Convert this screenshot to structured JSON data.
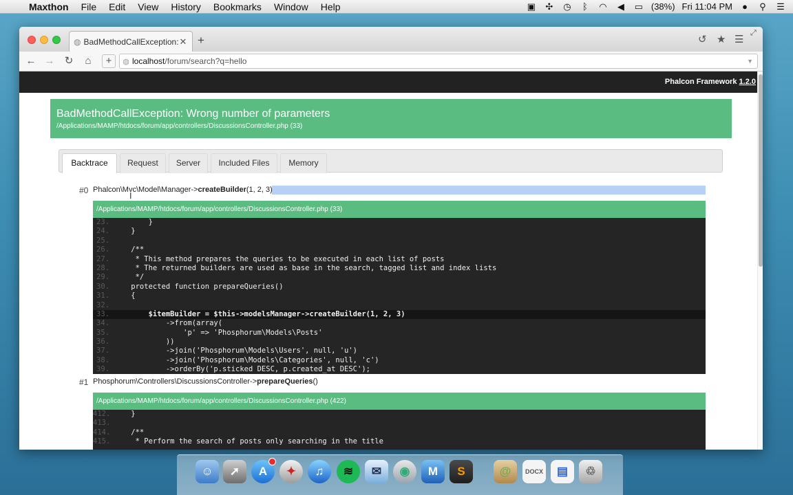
{
  "menubar": {
    "app_name": "Maxthon",
    "items": [
      "File",
      "Edit",
      "View",
      "History",
      "Bookmarks",
      "Window",
      "Help"
    ],
    "battery": "(38%)",
    "clock": "Fri 11:04 PM"
  },
  "browser": {
    "tab_title": "BadMethodCallException: W",
    "url_host": "localhost",
    "url_path": "/forum/search?q=hello"
  },
  "page": {
    "framework_label": "Phalcon Framework",
    "framework_version": "1.2.0",
    "error_title": "BadMethodCallException: Wrong number of parameters",
    "error_path": "/Applications/MAMP/htdocs/forum/app/controllers/DiscussionsController.php (33)",
    "tabs": [
      "Backtrace",
      "Request",
      "Server",
      "Included Files",
      "Memory"
    ],
    "trace0": {
      "num": "#0",
      "prefix": "Phalcon\\Mvc\\Model\\Manager->",
      "method": "createBuilder",
      "args": "(1, 2, 3)",
      "file": "/Applications/MAMP/htdocs/forum/app/controllers/DiscussionsController.php (33)"
    },
    "trace1": {
      "num": "#1",
      "prefix": "Phosphorum\\Controllers\\DiscussionsController->",
      "method": "prepareQueries",
      "args": "()",
      "file": "/Applications/MAMP/htdocs/forum/app/controllers/DiscussionsController.php (422)"
    },
    "code0": [
      {
        "num": "23.",
        "text": "        }"
      },
      {
        "num": "24.",
        "text": "    }"
      },
      {
        "num": "25.",
        "text": ""
      },
      {
        "num": "26.",
        "text": "    /**"
      },
      {
        "num": "27.",
        "text": "     * This method prepares the queries to be executed in each list of posts"
      },
      {
        "num": "28.",
        "text": "     * The returned builders are used as base in the search, tagged list and index lists"
      },
      {
        "num": "29.",
        "text": "     */"
      },
      {
        "num": "30.",
        "text": "    protected function prepareQueries()"
      },
      {
        "num": "31.",
        "text": "    {"
      },
      {
        "num": "32.",
        "text": ""
      },
      {
        "num": "33.",
        "text": "        $itemBuilder = $this->modelsManager->createBuilder(1, 2, 3)"
      },
      {
        "num": "34.",
        "text": "            ->from(array("
      },
      {
        "num": "35.",
        "text": "                'p' => 'Phosphorum\\Models\\Posts'"
      },
      {
        "num": "36.",
        "text": "            ))"
      },
      {
        "num": "37.",
        "text": "            ->join('Phosphorum\\Models\\Users', null, 'u')"
      },
      {
        "num": "38.",
        "text": "            ->join('Phosphorum\\Models\\Categories', null, 'c')"
      },
      {
        "num": "39.",
        "text": "            ->orderBy('p.sticked DESC, p.created_at DESC');"
      }
    ],
    "code1": [
      {
        "num": "412.",
        "text": "    }"
      },
      {
        "num": "413.",
        "text": ""
      },
      {
        "num": "414.",
        "text": "    /**"
      },
      {
        "num": "415.",
        "text": "     * Perform the search of posts only searching in the title"
      }
    ]
  },
  "colors": {
    "accent_green": "#5bbc82",
    "code_bg": "#252525",
    "header_bg": "#222222"
  }
}
